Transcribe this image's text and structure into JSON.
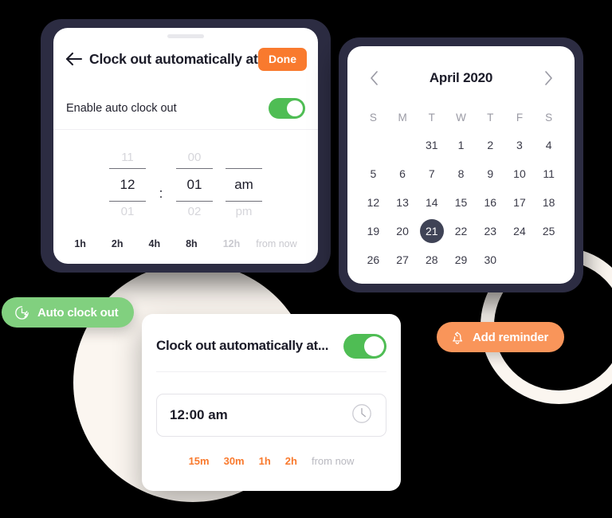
{
  "background": {
    "page_color": "#000000",
    "decoration_color": "#fbf6f0",
    "frame_color": "#2c2c42"
  },
  "colors": {
    "accent_orange": "#f97a2e",
    "badge_orange": "#f9955a",
    "toggle_green": "#4fbd54",
    "badge_green": "#81d07f",
    "selected_day": "#3f4356",
    "text_dark": "#1b1b28",
    "text_muted": "#9a9aa4"
  },
  "card_timepicker": {
    "back_icon": "back-arrow-icon",
    "title": "Clock out automatically at...",
    "done_label": "Done",
    "enable_label": "Enable auto clock out",
    "toggle_state": "on",
    "wheel": {
      "hour": {
        "prev": "11",
        "current": "12",
        "next": "01"
      },
      "separator": ":",
      "minute": {
        "prev": "00",
        "current": "01",
        "next": "02"
      },
      "meridiem": {
        "prev": "",
        "current": "am",
        "next": "pm"
      }
    },
    "shortcuts": [
      {
        "label": "1h",
        "muted": false
      },
      {
        "label": "2h",
        "muted": false
      },
      {
        "label": "4h",
        "muted": false
      },
      {
        "label": "8h",
        "muted": false
      },
      {
        "label": "12h",
        "muted": true
      }
    ],
    "shortcut_suffix": "from now"
  },
  "card_calendar": {
    "prev_icon": "chevron-left-icon",
    "next_icon": "chevron-right-icon",
    "month_label": "April 2020",
    "day_headers": [
      "S",
      "M",
      "T",
      "W",
      "T",
      "F",
      "S"
    ],
    "weeks": [
      [
        "",
        "",
        "31",
        "1",
        "2",
        "3",
        "4"
      ],
      [
        "5",
        "6",
        "7",
        "8",
        "9",
        "10",
        "11"
      ],
      [
        "12",
        "13",
        "14",
        "15",
        "16",
        "17",
        "18"
      ],
      [
        "19",
        "20",
        "21",
        "22",
        "23",
        "24",
        "25"
      ],
      [
        "26",
        "27",
        "28",
        "29",
        "30",
        "",
        ""
      ]
    ],
    "selected_day": "21"
  },
  "card_auto_clockout": {
    "title": "Clock out automatically at...",
    "toggle_state": "on",
    "time_value": "12:00 am",
    "clock_icon": "clock-icon",
    "shortcuts": [
      "15m",
      "30m",
      "1h",
      "2h"
    ],
    "shortcut_suffix": "from now"
  },
  "badges": {
    "auto_clockout": {
      "label": "Auto clock out",
      "icon": "clock-bolt-icon"
    },
    "add_reminder": {
      "label": "Add reminder",
      "icon": "bell-icon"
    }
  }
}
